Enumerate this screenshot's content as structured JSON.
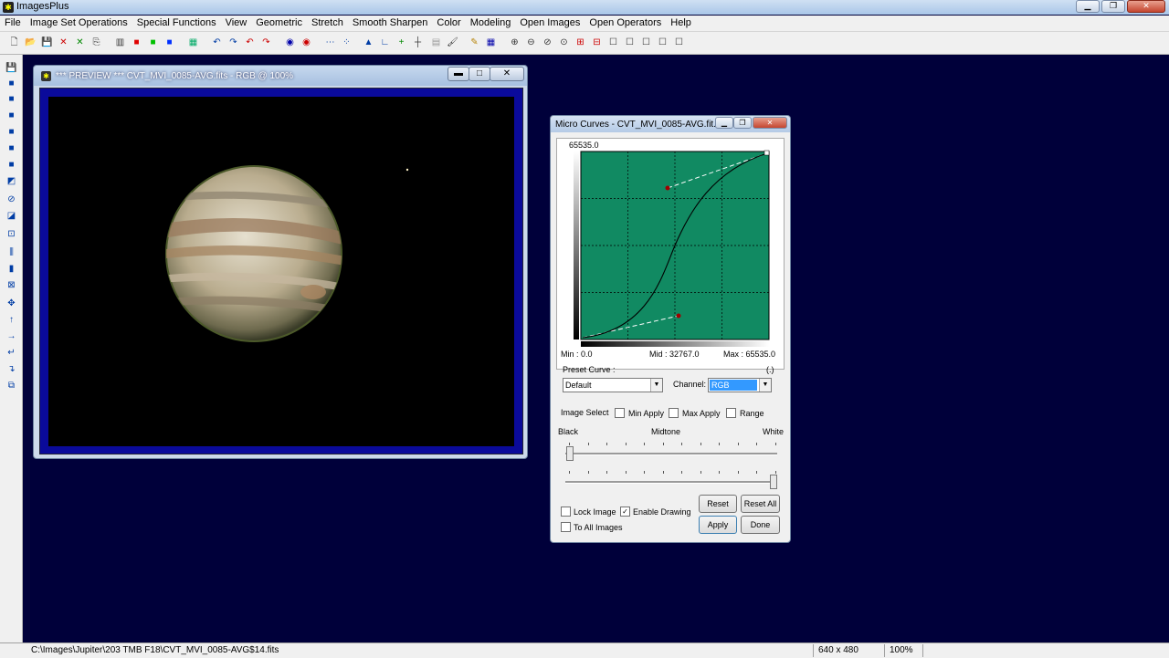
{
  "app": {
    "title": "ImagesPlus"
  },
  "window_controls": {
    "minimize": "▁",
    "restore": "❐",
    "close": "✕"
  },
  "menu": [
    "File",
    "Image Set Operations",
    "Special Functions",
    "View",
    "Geometric",
    "Stretch",
    "Smooth Sharpen",
    "Color",
    "Modeling",
    "Open Images",
    "Open Operators",
    "Help"
  ],
  "toolbar": {
    "icons": [
      "new-icon",
      "open-icon",
      "save-icon",
      "close-image-icon",
      "clear-icon",
      "copy-icon",
      "rgb-channels-icon",
      "red-channel-icon",
      "green-channel-icon",
      "blue-channel-icon",
      "grid-icon",
      "undo-icon",
      "redo-icon",
      "undo-all-icon",
      "redo-all-icon",
      "record-icon",
      "stop-record-icon",
      "line-dots-icon",
      "pixel-select-icon",
      "histogram-icon",
      "level-icon",
      "crosshair-add-icon",
      "crosshair-icon",
      "tile-icon",
      "palette-icon",
      "pencil-icon",
      "grid-table-icon",
      "zoom-in-icon",
      "zoom-out-icon",
      "zoom-fit-icon",
      "zoom-actual-icon",
      "add-frame-icon",
      "remove-frame-icon",
      "frame-1-icon",
      "frame-2-icon",
      "frame-3-icon",
      "frame-4-icon",
      "frame-5-icon"
    ],
    "glyphs": [
      "🗋",
      "📂",
      "💾",
      "✕",
      "✕",
      "⎘",
      "▥",
      "■",
      "■",
      "■",
      "▦",
      "↶",
      "↷",
      "↶",
      "↷",
      "◉",
      "◉",
      "⋯",
      "⁘",
      "▲",
      "∟",
      "+",
      "┼",
      "▤",
      "🖌",
      "✎",
      "▦",
      "⊕",
      "⊖",
      "⊘",
      "⊙",
      "⊞",
      "⊟",
      "☐",
      "☐",
      "☐",
      "☐",
      "☐"
    ],
    "colors": [
      "#333",
      "#b8860b",
      "#1a3a8a",
      "#c00",
      "#080",
      "#333",
      "#333",
      "#e00000",
      "#00c000",
      "#0030ff",
      "#0a6",
      "#003da5",
      "#003da5",
      "#c00",
      "#c00",
      "#00a",
      "#c00",
      "#003da5",
      "#003da5",
      "#003da5",
      "#003da5",
      "#080",
      "#333",
      "#999",
      "#333",
      "#b8860b",
      "#00a",
      "#333",
      "#333",
      "#333",
      "#333",
      "#c00",
      "#c00",
      "#333",
      "#333",
      "#333",
      "#333",
      "#333"
    ]
  },
  "left_toolbar": {
    "icons": [
      "save-tool-icon",
      "black-icon",
      "red-black-icon",
      "green-black-icon",
      "blue-black-icon",
      "yellow-black-icon",
      "gray-black-icon",
      "white-black-icon",
      "stamp-icon",
      "gradient-icon",
      "select-box-icon",
      "levels-icon",
      "bw-icon",
      "zoom-rect-icon",
      "move-icon",
      "up-arrow-icon",
      "right-arrow-icon",
      "rotate-left-icon",
      "rotate-down-icon",
      "flip-icon"
    ],
    "glyphs": [
      "💾",
      "■",
      "■",
      "■",
      "■",
      "■",
      "■",
      "◩",
      "⊘",
      "◪",
      "⊡",
      "⫼",
      "▮",
      "⊠",
      "✥",
      "↑",
      "→",
      "↵",
      "↴",
      "⧉"
    ]
  },
  "preview_window": {
    "title": "*** PREVIEW *** CVT_MVI_0085-AVG.fits - RGB @ 100%",
    "btn_min": "▬",
    "btn_max": "□",
    "btn_close": "✕"
  },
  "micro_curves": {
    "title": "Micro Curves - CVT_MVI_0085-AVG.fit...",
    "top_value": "65535.0",
    "min_label": "Min :  0.0",
    "mid_label": "Mid :  32767.0",
    "max_label": "Max :  65535.0",
    "preset_label": "Preset Curve :",
    "brackets": "(.)",
    "preset_value": "Default",
    "channel_label": "Channel:",
    "channel_value": "RGB",
    "image_select_label": "Image Select",
    "min_apply": "Min Apply",
    "max_apply": "Max Apply",
    "range": "Range",
    "black": "Black",
    "midtone": "Midtone",
    "white": "White",
    "reset": "Reset",
    "reset_all": "Reset All",
    "lock_image": "Lock Image",
    "enable_drawing": "Enable Drawing",
    "to_all_images": "To All Images",
    "apply": "Apply",
    "done": "Done",
    "enable_drawing_checked": true,
    "curve_color": "#118a62",
    "control_point_color": "#a00000"
  },
  "status": {
    "path": "C:\\Images\\Jupiter\\203 TMB F18\\CVT_MVI_0085-AVG$14.fits",
    "dimensions": "640 x 480",
    "zoom": "100%"
  }
}
